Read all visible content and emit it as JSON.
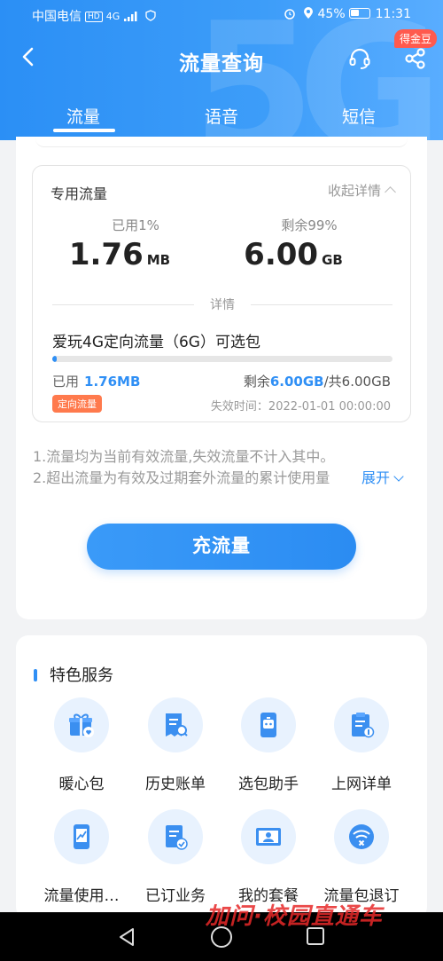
{
  "status_bar": {
    "carrier": "中国电信",
    "hd": "HD",
    "network": "4G",
    "battery": "45%",
    "time": "11:31"
  },
  "header": {
    "title": "流量查询",
    "badge": "得金豆",
    "bg_mark": "5G"
  },
  "tabs": [
    {
      "label": "流量",
      "active": true
    },
    {
      "label": "语音",
      "active": false
    },
    {
      "label": "短信",
      "active": false
    }
  ],
  "flow_card": {
    "title": "专用流量",
    "collapse_label": "收起详情",
    "used_label": "已用1%",
    "used_value": "1.76",
    "used_unit": "MB",
    "remain_label": "剩余99%",
    "remain_value": "6.00",
    "remain_unit": "GB",
    "detail_label": "详情",
    "package_name": "爱玩4G定向流量（6G）可选包",
    "progress_fraction": 0.01,
    "used_text_label": "已用",
    "used_text_value": "1.76MB",
    "remain_text_label": "剩余",
    "remain_text_value": "6.00GB",
    "total_text": "/共6.00GB",
    "tag": "定向流量",
    "expire": "失效时间：2022-01-01 00:00:00"
  },
  "notes": {
    "line1": "1.流量均为当前有效流量,失效流量不计入其中。",
    "line2": "2.超出流量为有效及过期套外流量的累计使用量",
    "expand_label": "展开"
  },
  "recharge_button": "充流量",
  "services": {
    "title": "特色服务",
    "items": [
      {
        "label": "暖心包",
        "icon": "gift-icon"
      },
      {
        "label": "历史账单",
        "icon": "bill-search-icon"
      },
      {
        "label": "选包助手",
        "icon": "phone-robot-icon"
      },
      {
        "label": "上网详单",
        "icon": "clipboard-list-icon"
      },
      {
        "label": "流量使用…",
        "icon": "phone-chart-icon"
      },
      {
        "label": "已订业务",
        "icon": "document-check-icon"
      },
      {
        "label": "我的套餐",
        "icon": "id-card-icon"
      },
      {
        "label": "流量包退订",
        "icon": "wifi-cancel-icon"
      }
    ]
  },
  "watermark": "加问·校园直通车",
  "colors": {
    "primary": "#2f8ff5",
    "badge": "#ff5a4e",
    "tag": "#ff7a4d"
  }
}
